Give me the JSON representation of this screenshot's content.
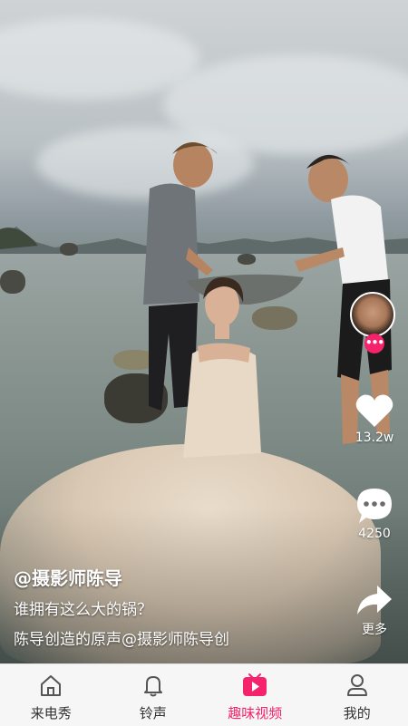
{
  "video": {
    "author": "@摄影师陈导",
    "title": "谁拥有这么大的锅？",
    "music": "陈导创造的原声@摄影师陈导创"
  },
  "side_actions": {
    "follow_icon": "more-dots-icon",
    "like_count": "13.2w",
    "comment_count": "4250",
    "share_label": "更多"
  },
  "tabbar": {
    "tabs": [
      {
        "label": "来电秀",
        "icon": "home-icon",
        "active": false
      },
      {
        "label": "铃声",
        "icon": "bell-icon",
        "active": false
      },
      {
        "label": "趣味视频",
        "icon": "video-play-icon",
        "active": true
      },
      {
        "label": "我的",
        "icon": "profile-icon",
        "active": false
      }
    ],
    "active_color": "#f5236c"
  }
}
